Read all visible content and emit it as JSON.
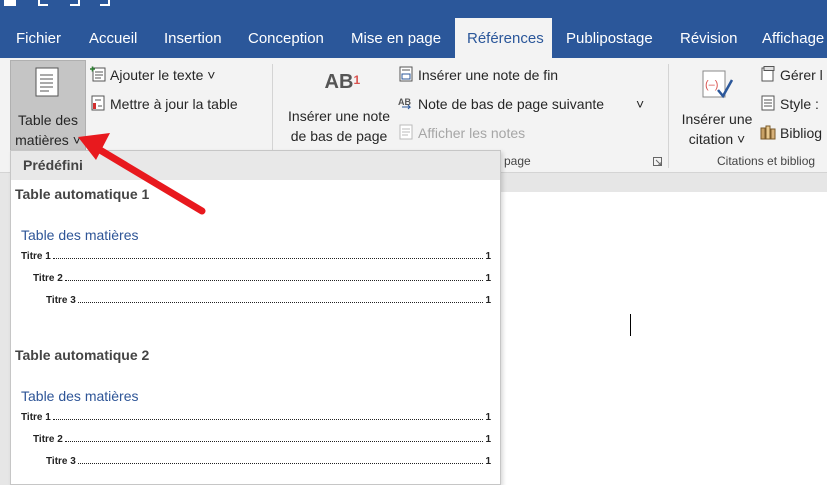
{
  "ribbon_tabs": [
    "Fichier",
    "Accueil",
    "Insertion",
    "Conception",
    "Mise en page",
    "Références",
    "Publipostage",
    "Révision",
    "Affichage"
  ],
  "active_tab": "Références",
  "ribbon": {
    "toc_button": {
      "line1": "Table des",
      "line2": "matières ˅"
    },
    "add_text": "Ajouter le texte ˅",
    "update_table": "Mettre à jour la table",
    "insert_footnote": {
      "line1": "Insérer une note",
      "line2": "de bas de page"
    },
    "footnote_icon_text": "AB",
    "insert_endnote": "Insérer une note de fin",
    "next_footnote": "Note de bas de page suivante",
    "next_footnote_caret": "˅",
    "show_notes": "Afficher les notes",
    "footnotes_group_label_visible": "page",
    "insert_citation": {
      "line1": "Insérer une",
      "line2": "citation ˅"
    },
    "manage_sources": "Gérer l",
    "style": "Style :",
    "bibliography": "Bibliog",
    "citations_group_label": "Citations et bibliog"
  },
  "dropdown": {
    "header": "Prédéfini",
    "entries": [
      {
        "title": "Table automatique 1",
        "toc_heading": "Table des matières",
        "lines": [
          {
            "label": "Titre 1",
            "page": "1"
          },
          {
            "label": "Titre 2",
            "page": "1"
          },
          {
            "label": "Titre 3",
            "page": "1"
          }
        ]
      },
      {
        "title": "Table automatique 2",
        "toc_heading": "Table des matières",
        "lines": [
          {
            "label": "Titre 1",
            "page": "1"
          },
          {
            "label": "Titre 2",
            "page": "1"
          },
          {
            "label": "Titre 3",
            "page": "1"
          }
        ]
      }
    ]
  },
  "colors": {
    "ribbon_blue": "#2b579a",
    "toc_heading_blue": "#2e5597",
    "arrow_red": "#e8191e"
  }
}
